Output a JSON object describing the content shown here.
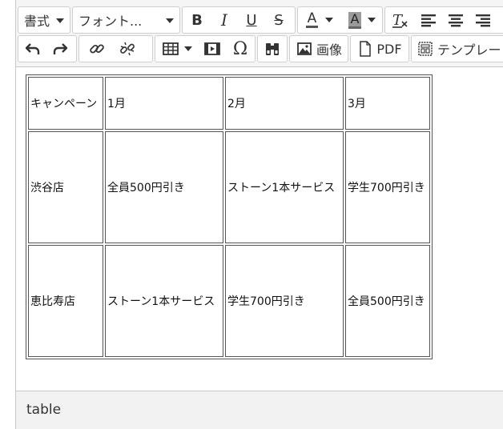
{
  "toolbar": {
    "format_label": "書式",
    "font_label": "フォント...",
    "bold_label": "B",
    "italic_label": "I",
    "underline_label": "U",
    "strike_label": "S",
    "textcolor_label": "A",
    "bgcolor_label": "A",
    "image_label": "画像",
    "pdf_label": "PDF",
    "template_label": "テンプレート"
  },
  "table": {
    "rows": [
      [
        "キャンペーン",
        "1月",
        "2月",
        "3月"
      ],
      [
        "渋谷店",
        "全員500円引き",
        "ストーン1本サービス",
        "学生700円引き"
      ],
      [
        "恵比寿店",
        "ストーン1本サービス",
        "学生700円引き",
        "全員500円引き"
      ]
    ]
  },
  "statusbar": {
    "path": "table"
  },
  "colors": {
    "toolbar_bg": "#f5f5f5",
    "border": "#c8c8c8",
    "icon": "#333333"
  }
}
